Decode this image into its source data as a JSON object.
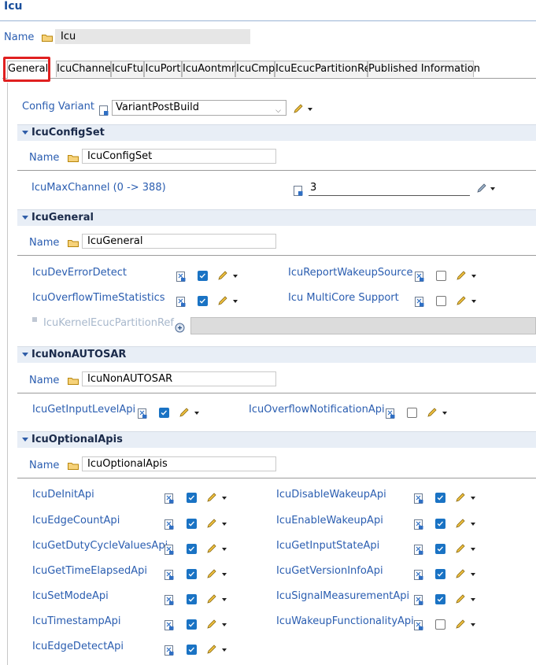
{
  "title": "Icu",
  "top_name": {
    "label": "Name",
    "value": "Icu"
  },
  "tabs": [
    "General",
    "IcuChannel",
    "IcuFtu",
    "IcuPort",
    "IcuAontmr",
    "IcuCmp",
    "IcuEcucPartitionRef",
    "Published Information"
  ],
  "active_tab": "General",
  "config_variant": {
    "label": "Config Variant",
    "value": "VariantPostBuild"
  },
  "config_set": {
    "header": "IcuConfigSet",
    "name_label": "Name",
    "name_value": "IcuConfigSet",
    "max_channel_label": "IcuMaxChannel (0 -> 388)",
    "max_channel_value": "3"
  },
  "general": {
    "header": "IcuGeneral",
    "name_label": "Name",
    "name_value": "IcuGeneral",
    "params": [
      {
        "label": "IcuDevErrorDetect",
        "checked": true
      },
      {
        "label": "IcuReportWakeupSource",
        "checked": false
      },
      {
        "label": "IcuOverflowTimeStatistics",
        "checked": true
      },
      {
        "label": "Icu MultiCore Support",
        "checked": false
      }
    ],
    "kernel_ref_label": "IcuKernelEcucPartitionRef"
  },
  "non_autosar": {
    "header": "IcuNonAUTOSAR",
    "name_label": "Name",
    "name_value": "IcuNonAUTOSAR",
    "params": [
      {
        "label": "IcuGetInputLevelApi",
        "checked": true
      },
      {
        "label": "IcuOverflowNotificationApi",
        "checked": false
      }
    ]
  },
  "optional_apis": {
    "header": "IcuOptionalApis",
    "name_label": "Name",
    "name_value": "IcuOptionalApis",
    "params": [
      {
        "label": "IcuDeInitApi",
        "checked": true
      },
      {
        "label": "IcuDisableWakeupApi",
        "checked": true
      },
      {
        "label": "IcuEdgeCountApi",
        "checked": true
      },
      {
        "label": "IcuEnableWakeupApi",
        "checked": true
      },
      {
        "label": "IcuGetDutyCycleValuesApi",
        "checked": true
      },
      {
        "label": "IcuGetInputStateApi",
        "checked": true
      },
      {
        "label": "IcuGetTimeElapsedApi",
        "checked": true
      },
      {
        "label": "IcuGetVersionInfoApi",
        "checked": true
      },
      {
        "label": "IcuSetModeApi",
        "checked": true
      },
      {
        "label": "IcuSignalMeasurementApi",
        "checked": true
      },
      {
        "label": "IcuTimestampApi",
        "checked": true
      },
      {
        "label": "IcuWakeupFunctionalityApi",
        "checked": false
      },
      {
        "label": "IcuEdgeDetectApi",
        "checked": true
      }
    ]
  },
  "icons": [
    "folder-icon",
    "document-icon",
    "checkbox",
    "pencil-icon",
    "dropdown-arrow-icon",
    "link-icon"
  ],
  "colors": {
    "label_blue": "#2a5db0",
    "checkbox_blue": "#1a73c4",
    "section_bg": "#e8eef6",
    "highlight_red": "#e02020"
  }
}
